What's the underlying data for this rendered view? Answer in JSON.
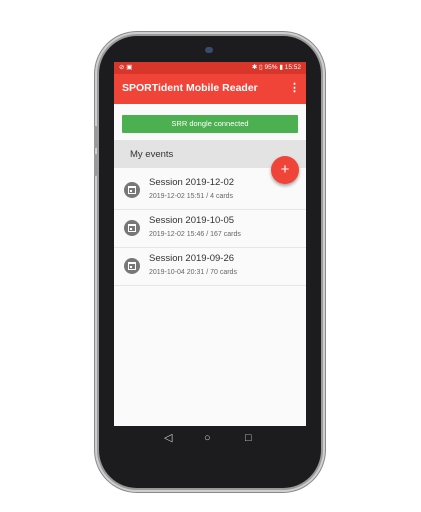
{
  "status_bar": {
    "left": "⊘ ▣",
    "right": "✱ ▯ 95% ▮ 15:52"
  },
  "app_bar": {
    "title": "SPORTident Mobile Reader",
    "menu_icon": "more-vert-icon"
  },
  "banner": {
    "text": "SRR dongle connected",
    "color": "#4caf50"
  },
  "section": {
    "title": "My events"
  },
  "fab": {
    "label": "+",
    "color": "#f04438"
  },
  "events": [
    {
      "name": "Session 2019-12-02",
      "details": "2019-12-02 15:51 / 4 cards"
    },
    {
      "name": "Session 2019-10-05",
      "details": "2019-12-02 15:46 / 167 cards"
    },
    {
      "name": "Session 2019-09-26",
      "details": "2019-10-04 20:31 / 70 cards"
    }
  ],
  "nav_bar": {
    "back": "◁",
    "home": "○",
    "recents": "□"
  },
  "colors": {
    "accent": "#f04438",
    "status_bar": "#d8352b"
  }
}
